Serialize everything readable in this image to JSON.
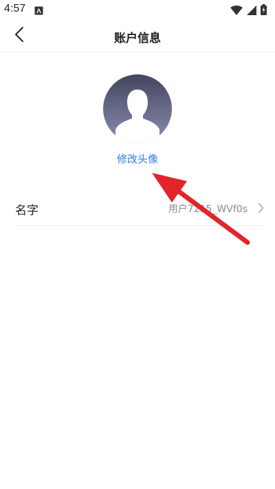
{
  "status_bar": {
    "time": "4:57",
    "icons": [
      "app-notification-icon",
      "wifi-icon",
      "cell-signal-icon",
      "battery-icon"
    ]
  },
  "header": {
    "title": "账户信息",
    "back_icon": "chevron-left-icon"
  },
  "profile": {
    "avatar_icon": "default-user-avatar",
    "change_avatar_label": "修改头像"
  },
  "rows": [
    {
      "label": "名字",
      "value": "用户7215_WVf0s",
      "icon": "chevron-right-icon"
    }
  ],
  "colors": {
    "link": "#2b7de9",
    "annotation_arrow": "#e3242b",
    "avatar_bg": "#5a5c78"
  }
}
